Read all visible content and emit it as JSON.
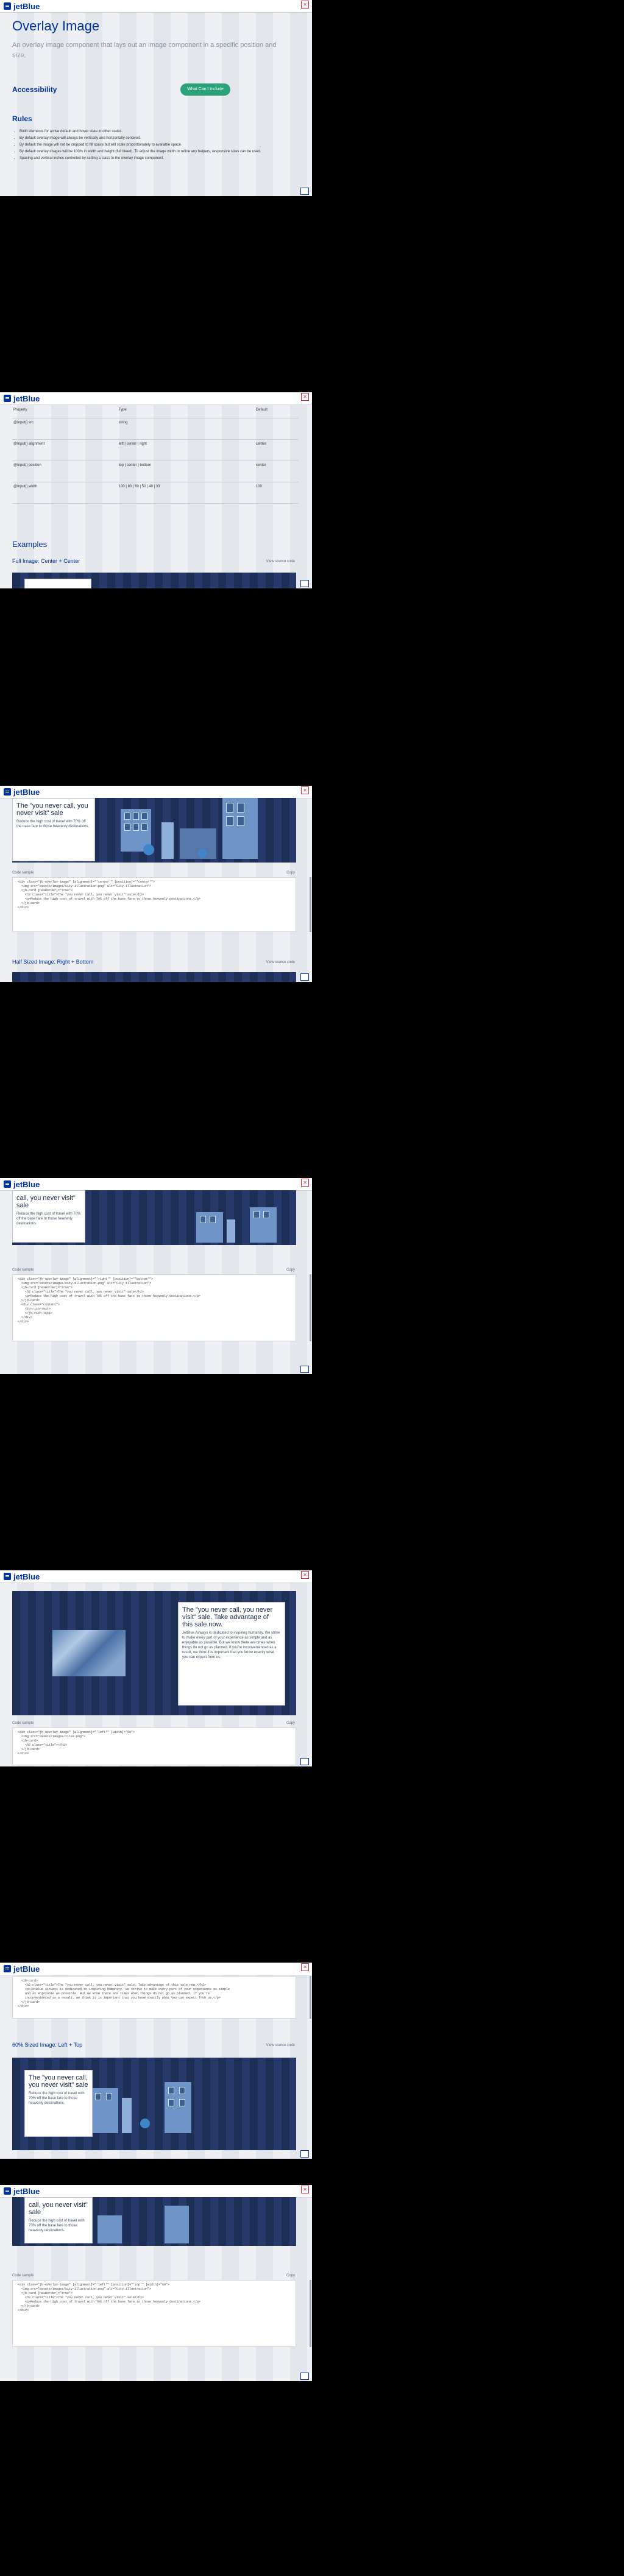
{
  "app": {
    "logo": "jetBlue",
    "close": "✕"
  },
  "page": {
    "title": "Overlay Image",
    "lead": "An overlay image component that lays out an image component in a specific position and size.",
    "accessibility_heading": "Accessibility",
    "accessibility_button": "What Can I Include",
    "rules_heading": "Rules",
    "rules": [
      "Build elements for active default and hover state in other states.",
      "By default overlay image will always be vertically and horizontally centered.",
      "By default the image will not be cropped to fill space but will scale proportionately to available space.",
      "By default overlay images will be 100% in width and height (full bleed). To adjust the image width or refine any helpers, responsive sizes can be used.",
      "Spacing and vertical inches controlled by setting a class to the overlay image component."
    ]
  },
  "props_table": {
    "headers": [
      "Property",
      "Type",
      "Default"
    ],
    "rows": [
      {
        "prop": "@Input() src",
        "type": "string",
        "def": ""
      },
      {
        "prop": "@Input() alignment",
        "type": "left | center | right",
        "def": "center"
      },
      {
        "prop": "@Input() position",
        "type": "top | center | bottom",
        "def": "center"
      },
      {
        "prop": "@Input() width",
        "type": "100 | 80 | 60 | 50 | 40 | 33",
        "def": "100"
      }
    ]
  },
  "examples": {
    "heading": "Examples",
    "ex1_title": "Full Image: Center + Center",
    "ex2_title": "Half Sized Image: Right + Bottom",
    "ex3_title": "60% Sized Image: Left + Top",
    "view_source": "View source code",
    "code_label": "Code sample",
    "copy": "Copy"
  },
  "card_short": {
    "title": "The \"you never call, you never visit\" sale",
    "title_cut": "call, you never visit\" sale",
    "title_60": "The \"you never call, you never visit\" sale",
    "body": "Reduce the high cost of travel with 70% off the base fare to those heavenly destinations."
  },
  "card_long": {
    "title": "The \"you never call, you never visit\" sale. Take advantage of this sale now.",
    "body": "JetBlue Airways is dedicated to inspiring humanity. We strive to make every part of your experience as simple and as enjoyable as possible. But we know there are times when things do not go as planned. If you're inconvenienced as a result, we think it is important that you know exactly what you can expect from us."
  },
  "code": {
    "ex1": "<div class=\"jb-overlay-image\" [alignment]=\"'center'\" [position]=\"'center'\">\n  <img src=\"assets/images/city-illustration.png\" alt=\"City illustration\">\n  <jb-card [hasBorder]=\"true\">\n    <h2 class=\"title\">The \"you never call, you never visit\" sale</h2>\n    <p>Reduce the high cost of travel with 70% off the base fare to those heavenly destinations.</p>\n  </jb-card>\n</div>",
    "ex2": "<div class=\"jb-overlay-image\" [alignment]=\"'right'\" [position]=\"'bottom'\">\n  <img src=\"assets/images/city-illustration.png\" alt=\"City illustration\">\n  <jb-card [hasBorder]=\"true\">\n    <h2 class=\"title\">The \"you never call, you never visit\" sale</h2>\n    <p>Reduce the high cost of travel with 70% off the base fare to those heavenly destinations.</p>\n  </jb-card>\n  <div class=\"content\">\n    <jb-rich-text>\n    </jb-rich-text>\n  </div>\n</div>",
    "ex2b": "<div class=\"jb-overlay-image\" [alignment]=\"'left'\" [width]=\"50\">\n  <img src=\"assets/images/tiles.png\">\n  <jb-card>\n    <h2 class=\"title\"></h2>\n  </jb-card>\n</div>",
    "ex3a": "  <jb-card>\n    <h2 class=\"title\">The \"you never call, you never visit\" sale. Take advantage of this sale now.</h2>\n    <p>JetBlue Airways is dedicated to inspiring humanity. We strive to make every part of your experience as simple\n    and as enjoyable as possible. But we know there are times when things do not go as planned. If you're\n    inconvenienced as a result, we think it is important that you know exactly what you can expect from us.</p>\n  </jb-card>\n</div>",
    "ex3": "<div class=\"jb-overlay-image\" [alignment]=\"'left'\" [position]=\"'top'\" [width]=\"60\">\n  <img src=\"assets/images/city-illustration.png\" alt=\"City illustration\">\n  <jb-card [hasBorder]=\"true\">\n    <h2 class=\"title\">The \"you never call, you never visit\" sale</h2>\n    <p>Reduce the high cost of travel with 70% off the base fare to those heavenly destinations.</p>\n  </jb-card>\n</div>"
  },
  "colors": {
    "brand": "#0033a0",
    "accent": "#2aa37a",
    "banner": "#1e2f55",
    "close": "#d8283c"
  },
  "icons": [
    "menu-icon",
    "close-icon",
    "expand-icon"
  ]
}
